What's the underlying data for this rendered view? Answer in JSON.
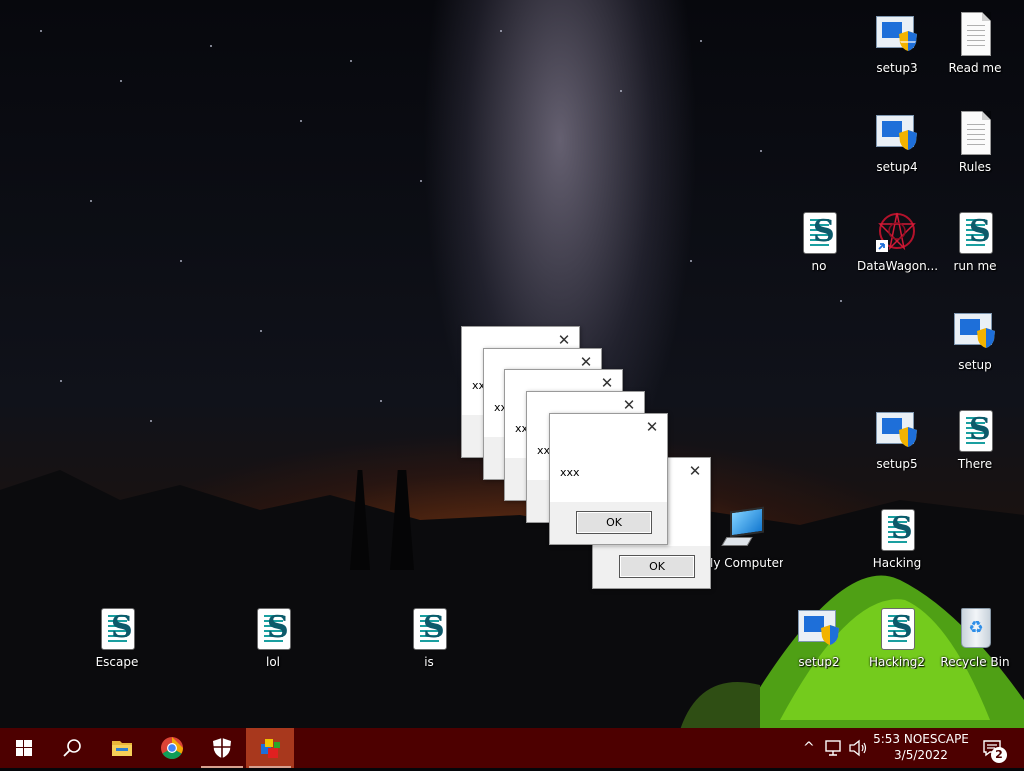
{
  "desktop": {
    "icons": [
      {
        "label": "setup3",
        "type": "setup"
      },
      {
        "label": "Read me",
        "type": "document"
      },
      {
        "label": "setup4",
        "type": "setup"
      },
      {
        "label": "Rules",
        "type": "document"
      },
      {
        "label": "no",
        "type": "script"
      },
      {
        "label": "DataWagon...",
        "type": "shortcut"
      },
      {
        "label": "run me",
        "type": "script"
      },
      {
        "label": "setup",
        "type": "setup"
      },
      {
        "label": "setup5",
        "type": "setup"
      },
      {
        "label": "There",
        "type": "script"
      },
      {
        "label": "My Computer",
        "type": "computer"
      },
      {
        "label": "Hacking",
        "type": "script"
      },
      {
        "label": "setup2",
        "type": "setup"
      },
      {
        "label": "Hacking2",
        "type": "script"
      },
      {
        "label": "Recycle Bin",
        "type": "recycle-bin"
      },
      {
        "label": "Escape",
        "type": "script"
      },
      {
        "label": "lol",
        "type": "script"
      },
      {
        "label": "is",
        "type": "script"
      }
    ]
  },
  "dialogs": [
    {
      "message": "xxx",
      "ok_label": "OK",
      "close_glyph": "✕"
    },
    {
      "message": "xxx",
      "ok_label": "OK",
      "close_glyph": "✕"
    },
    {
      "message": "xxx",
      "ok_label": "OK",
      "close_glyph": "✕"
    },
    {
      "message": "xxx",
      "ok_label": "OK",
      "close_glyph": "✕"
    },
    {
      "message": "xxx",
      "ok_label": "OK",
      "close_glyph": "✕"
    },
    {
      "message": "xxx",
      "ok_label": "OK",
      "close_glyph": "✕"
    }
  ],
  "taskbar": {
    "color": "#4d0000",
    "active_color": "#a8381d",
    "buttons": [
      "start-icon",
      "search-icon",
      "file-explorer-icon",
      "chrome-icon",
      "security-shield-icon",
      "program-icon"
    ],
    "clock_time": "5:53 NOESCAPE",
    "clock_date": "3/5/2022",
    "notification_count": "2",
    "tray_icons": [
      "chevron-up-icon",
      "network-icon",
      "volume-icon",
      "action-center-icon"
    ]
  }
}
